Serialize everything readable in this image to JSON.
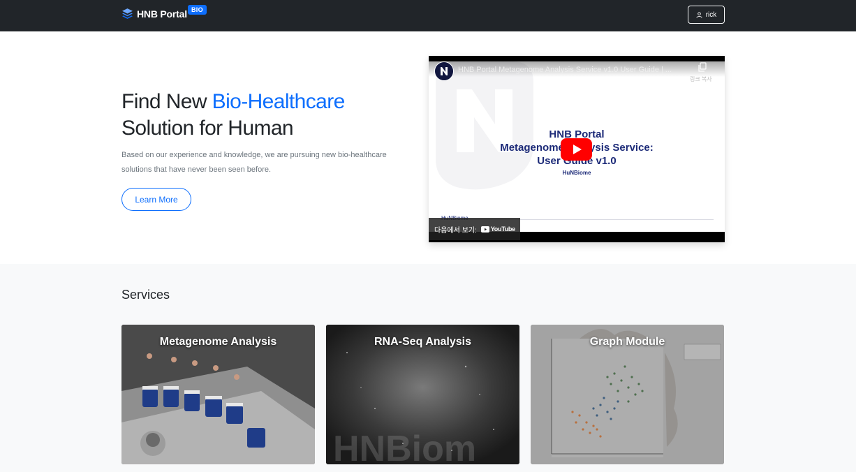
{
  "navbar": {
    "brand": "HNB Portal",
    "badge": "BIO",
    "user": "rick"
  },
  "hero": {
    "title_prefix": "Find New ",
    "title_accent": "Bio-Healthcare",
    "title_line2": "Solution for Human",
    "description": "Based on our experience and knowledge, we are pursuing new bio-healthcare solutions that have never been seen before.",
    "cta": "Learn More"
  },
  "video": {
    "title": "HNB Portal Metagenome Analysis Service v1.0 User Guide | ...",
    "copy_label": "링크 복사",
    "slide_title_line1": "HNB Portal",
    "slide_title_line2": "Metagenome Analysis Service:",
    "slide_title_line3": "User Guide v1.0",
    "slide_subtitle": "HuNBiome",
    "slide_footer_logo": "HuNBiome",
    "watch_on_label": "다음에서 보기:",
    "youtube_wordmark": "YouTube"
  },
  "services": {
    "title": "Services",
    "cards": [
      {
        "label": "Metagenome Analysis"
      },
      {
        "label": "RNA-Seq Analysis"
      },
      {
        "label": "Graph Module"
      }
    ]
  },
  "colors": {
    "navbar_bg": "#212529",
    "accent": "#0d6efd",
    "youtube_red": "#ff0000",
    "services_bg": "#f8f9fa"
  },
  "icons": [
    "layers-logo-icon",
    "user-icon",
    "copy-link-icon",
    "youtube-play-icon",
    "channel-avatar-icon"
  ]
}
